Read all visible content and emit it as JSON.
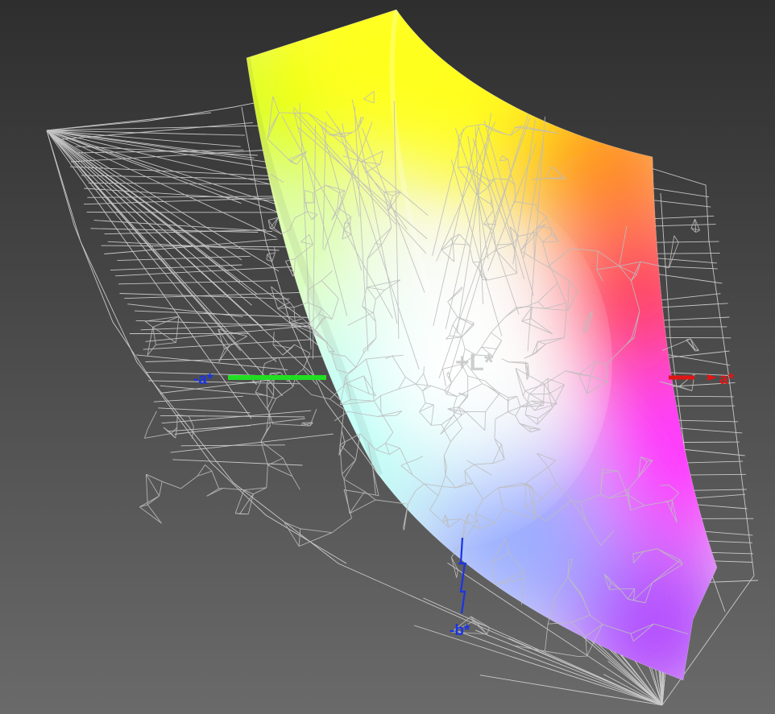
{
  "axes": {
    "neg_a": {
      "label": "-a*",
      "color": "#1a34e6",
      "line_color": "#22dd22"
    },
    "pos_a": {
      "label": "a*",
      "color": "#e01515",
      "line_color": "#e01515"
    },
    "neg_b": {
      "label": "-b*",
      "color": "#1a34e6",
      "line_color": "#1a34e6"
    },
    "pos_l": {
      "label": "+L*",
      "color": "#c9c9c9"
    }
  },
  "colors": {
    "background_top": "#2e2e2e",
    "background_bottom": "#6a6a6a",
    "wireframe": "#dcdcdc",
    "gamut_yellow": "#ffff1a",
    "gamut_green": "#c8ff00",
    "gamut_orange": "#ff8a18",
    "gamut_red": "#ff3b5c",
    "gamut_magenta": "#ff2fff",
    "gamut_violet": "#b040ff",
    "gamut_blue": "#9aaeff",
    "gamut_cyan": "#8ffff0"
  }
}
